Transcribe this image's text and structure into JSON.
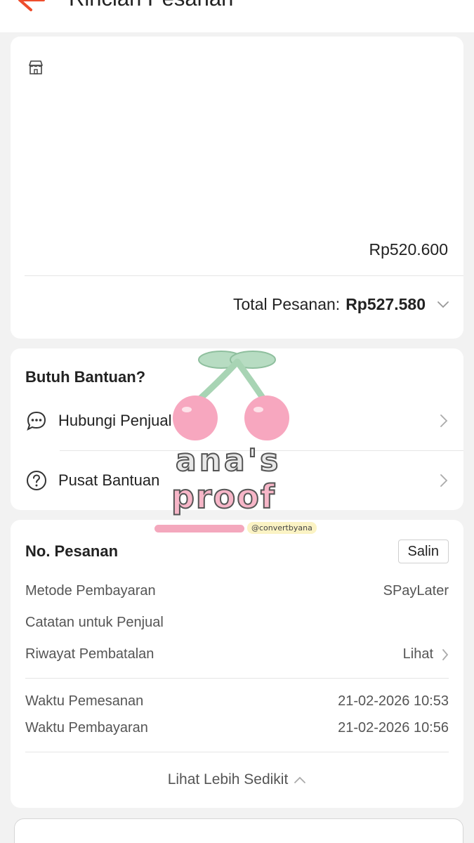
{
  "header": {
    "title": "Rincian Pesanan"
  },
  "product": {
    "price": "Rp520.600",
    "total_label": "Total Pesanan:",
    "total_amount": "Rp527.580"
  },
  "help": {
    "title": "Butuh Bantuan?",
    "items": [
      {
        "label": "Hubungi Penjual",
        "icon": "chat-icon"
      },
      {
        "label": "Pusat Bantuan",
        "icon": "question-icon"
      }
    ]
  },
  "order": {
    "title": "No. Pesanan",
    "copy_label": "Salin",
    "payment_method_label": "Metode Pembayaran",
    "payment_method_value": "SPayLater",
    "seller_note_label": "Catatan untuk Penjual",
    "cancel_history_label": "Riwayat Pembatalan",
    "cancel_history_value": "Lihat",
    "order_time_label": "Waktu Pemesanan",
    "order_time_value": "21-02-2026 10:53",
    "payment_time_label": "Waktu Pembayaran",
    "payment_time_value": "21-02-2026 10:56",
    "collapse_label": "Lihat Lebih Sedikit"
  },
  "watermark": {
    "line1": "ana's",
    "line2": "proof",
    "handle": "@convertbyana"
  },
  "colors": {
    "accent": "#ee4d2d",
    "pink": "#f7b6c8",
    "mint": "#b7dcc2"
  }
}
